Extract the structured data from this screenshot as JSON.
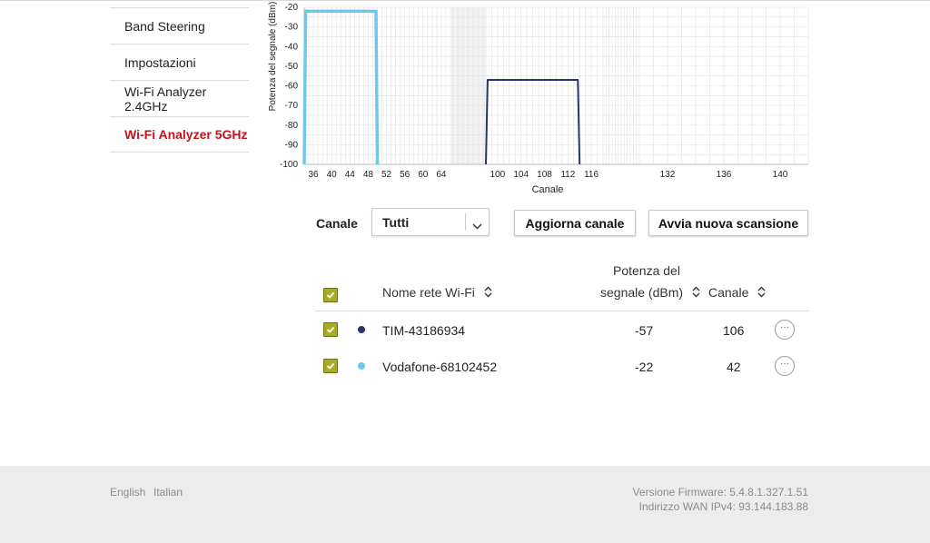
{
  "sidebar": {
    "items": [
      {
        "label": "Band Steering",
        "active": false
      },
      {
        "label": "Impostazioni",
        "active": false
      },
      {
        "label": "Wi-Fi Analyzer 2.4GHz",
        "active": false
      },
      {
        "label": "Wi-Fi Analyzer 5GHz",
        "active": true
      }
    ]
  },
  "chart_data": {
    "type": "area",
    "xlabel": "Canale",
    "ylabel": "Potenza del segnale (dBm)",
    "ylim": [
      -100,
      -20
    ],
    "yticks": [
      -20,
      -30,
      -40,
      -50,
      -60,
      -70,
      -80,
      -90,
      -100
    ],
    "xticks": [
      36,
      40,
      44,
      48,
      52,
      56,
      60,
      64,
      100,
      104,
      108,
      112,
      116,
      132,
      136,
      140
    ],
    "grid": true,
    "series": [
      {
        "name": "Vodafone-68102452",
        "channel": 42,
        "channel_start": 36,
        "channel_end": 48,
        "value": -22,
        "color": "#6ec6f1"
      },
      {
        "name": "TIM-43186934",
        "channel": 106,
        "channel_start": 100,
        "channel_end": 112,
        "value": -57,
        "color": "#2a3272"
      }
    ]
  },
  "controls": {
    "channel_label": "Canale",
    "channel_select_value": "Tutti",
    "refresh_button": "Aggiorna canale",
    "scan_button": "Avvia nuova scansione"
  },
  "table": {
    "headers": {
      "name": "Nome rete Wi-Fi",
      "power_line1": "Potenza del",
      "power_line2": "segnale (dBm)",
      "channel": "Canale"
    },
    "rows": [
      {
        "name": "TIM-43186934",
        "power": "-57",
        "channel": "106",
        "color": "#2a3272"
      },
      {
        "name": "Vodafone-68102452",
        "power": "-22",
        "channel": "42",
        "color": "#6ec6f1"
      }
    ],
    "more_glyph": "···"
  },
  "footer": {
    "lang_english": "English",
    "lang_italian": "Italian",
    "firmware": "Versione Firmware: 5.4.8.1.327.1.51",
    "wan": "Indirizzo WAN IPv4: 93.144.183.88"
  },
  "colors": {
    "accent": "#c4121c",
    "checkbox": "#a7ad24"
  },
  "icons": {
    "select_arrow": "chevron-down-icon",
    "sort": "sort-icon",
    "checkbox": "check-icon",
    "row_menu": "more-icon"
  }
}
